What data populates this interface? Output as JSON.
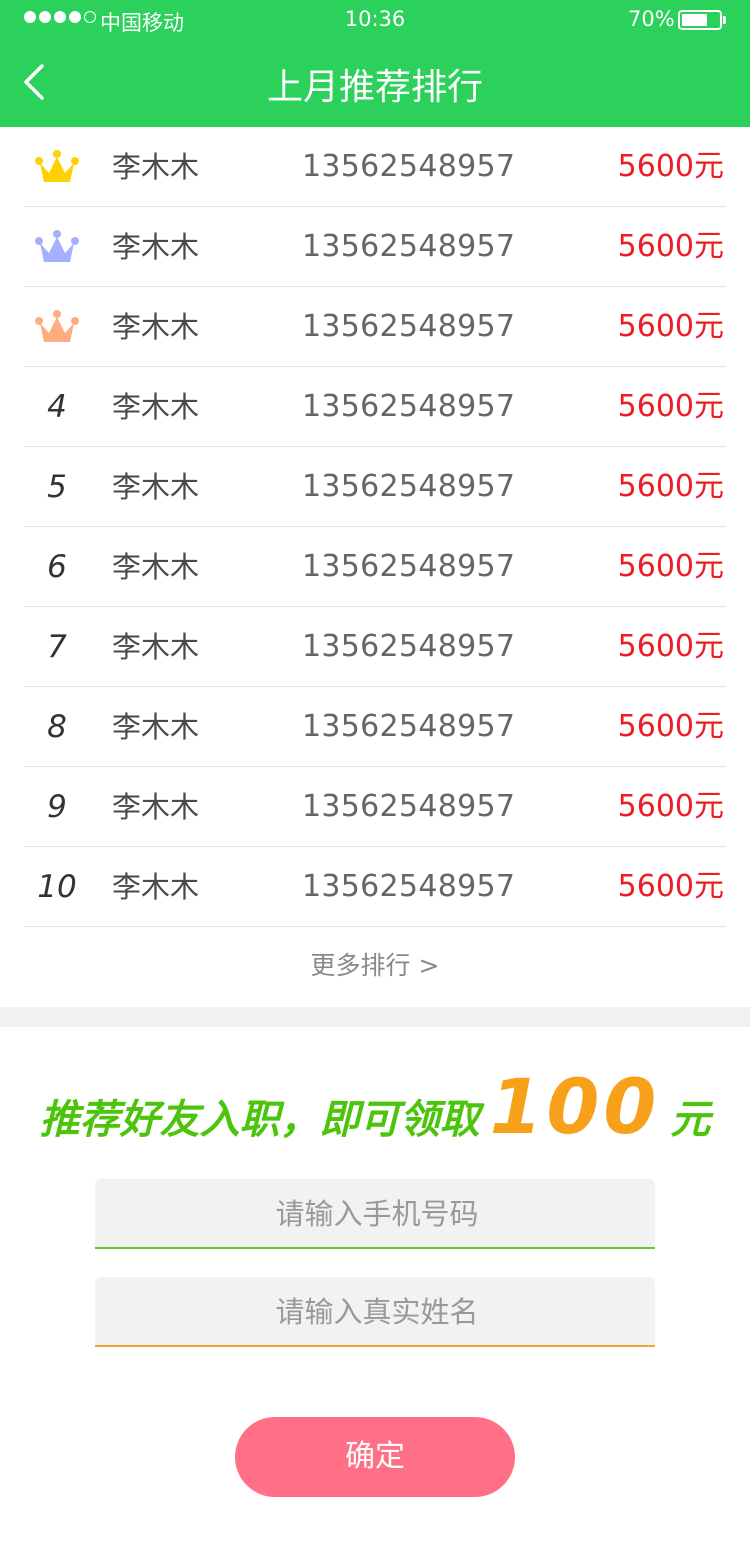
{
  "status_bar": {
    "carrier": "中国移动",
    "time": "10:36",
    "battery": "70%",
    "battery_level": 0.7,
    "signal_strength": 4
  },
  "header": {
    "title": "上月推荐排行",
    "back_icon": "chevron-left-icon"
  },
  "ranking": {
    "crown_colors": [
      "#ffd100",
      "#a6b0ff",
      "#ffac80"
    ],
    "rows": [
      {
        "rank": "1",
        "icon": "crown-gold-icon",
        "name": "李木木",
        "phone": "13562548957",
        "amount": "5600元"
      },
      {
        "rank": "2",
        "icon": "crown-silver-icon",
        "name": "李木木",
        "phone": "13562548957",
        "amount": "5600元"
      },
      {
        "rank": "3",
        "icon": "crown-bronze-icon",
        "name": "李木木",
        "phone": "13562548957",
        "amount": "5600元"
      },
      {
        "rank": "4",
        "name": "李木木",
        "phone": "13562548957",
        "amount": "5600元"
      },
      {
        "rank": "5",
        "name": "李木木",
        "phone": "13562548957",
        "amount": "5600元"
      },
      {
        "rank": "6",
        "name": "李木木",
        "phone": "13562548957",
        "amount": "5600元"
      },
      {
        "rank": "7",
        "name": "李木木",
        "phone": "13562548957",
        "amount": "5600元"
      },
      {
        "rank": "8",
        "name": "李木木",
        "phone": "13562548957",
        "amount": "5600元"
      },
      {
        "rank": "9",
        "name": "李木木",
        "phone": "13562548957",
        "amount": "5600元"
      },
      {
        "rank": "10",
        "name": "李木木",
        "phone": "13562548957",
        "amount": "5600元"
      }
    ],
    "more_label": "更多排行 >"
  },
  "promo": {
    "prefix": "推荐好友入职，即可领取",
    "amount": "100",
    "suffix": "元"
  },
  "form": {
    "phone_placeholder": "请输入手机号码",
    "phone_value": "",
    "name_placeholder": "请输入真实姓名",
    "name_value": "",
    "submit_label": "确定"
  },
  "colors": {
    "brand_green": "#2bd15a",
    "amount_red": "#ee1c24",
    "promo_green": "#4cc40c",
    "promo_orange": "#f7a11a",
    "button_pink": "#ff6f85"
  }
}
